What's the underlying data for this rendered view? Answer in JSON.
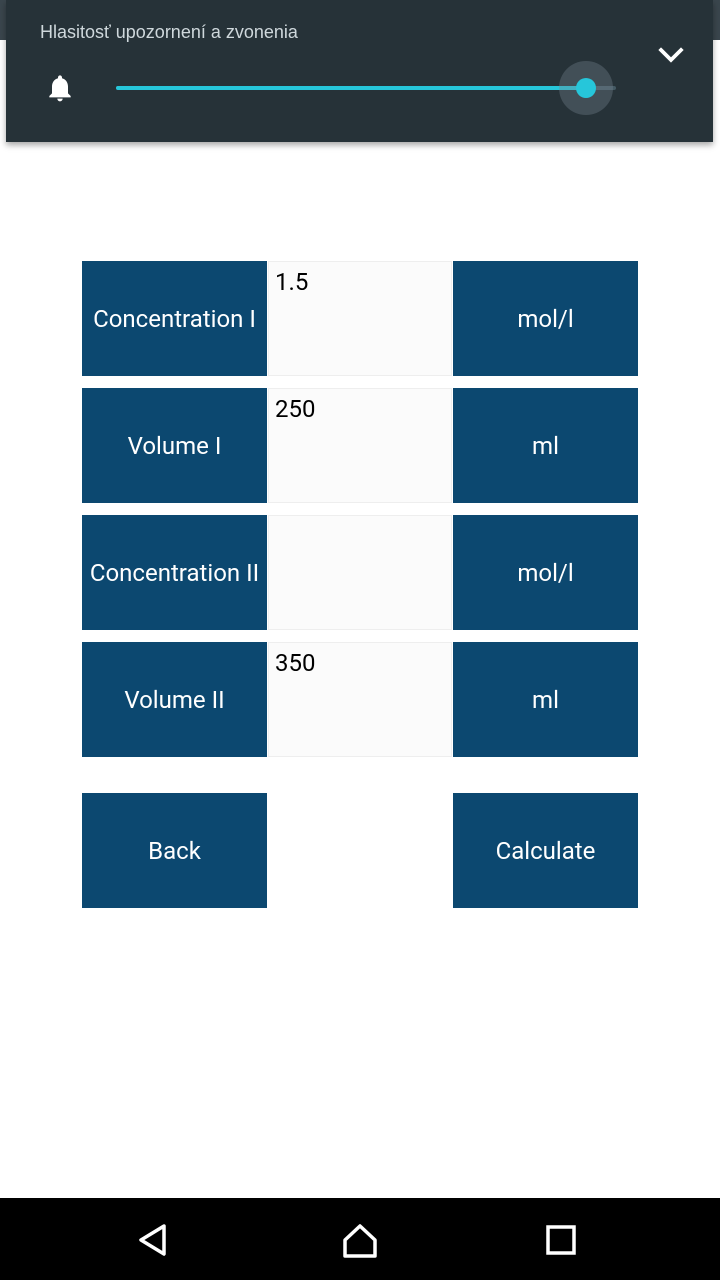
{
  "volume_panel": {
    "title": "Hlasitosť upozornení a zvonenia",
    "level": 0.94,
    "icons": {
      "bell": "bell-icon",
      "collapse": "chevron-down-icon"
    },
    "accent_color": "#26c6da"
  },
  "form": {
    "rows": [
      {
        "label": "Concentration I",
        "value": "1.5",
        "unit": "mol/l"
      },
      {
        "label": "Volume I",
        "value": "250",
        "unit": "ml"
      },
      {
        "label": "Concentration II",
        "value": "",
        "unit": "mol/l"
      },
      {
        "label": "Volume II",
        "value": "350",
        "unit": "ml"
      }
    ],
    "back_label": "Back",
    "calculate_label": "Calculate",
    "button_color": "#0c4870"
  },
  "nav_bar": {
    "icons": [
      "back-triangle-icon",
      "home-icon",
      "recents-square-icon"
    ]
  }
}
